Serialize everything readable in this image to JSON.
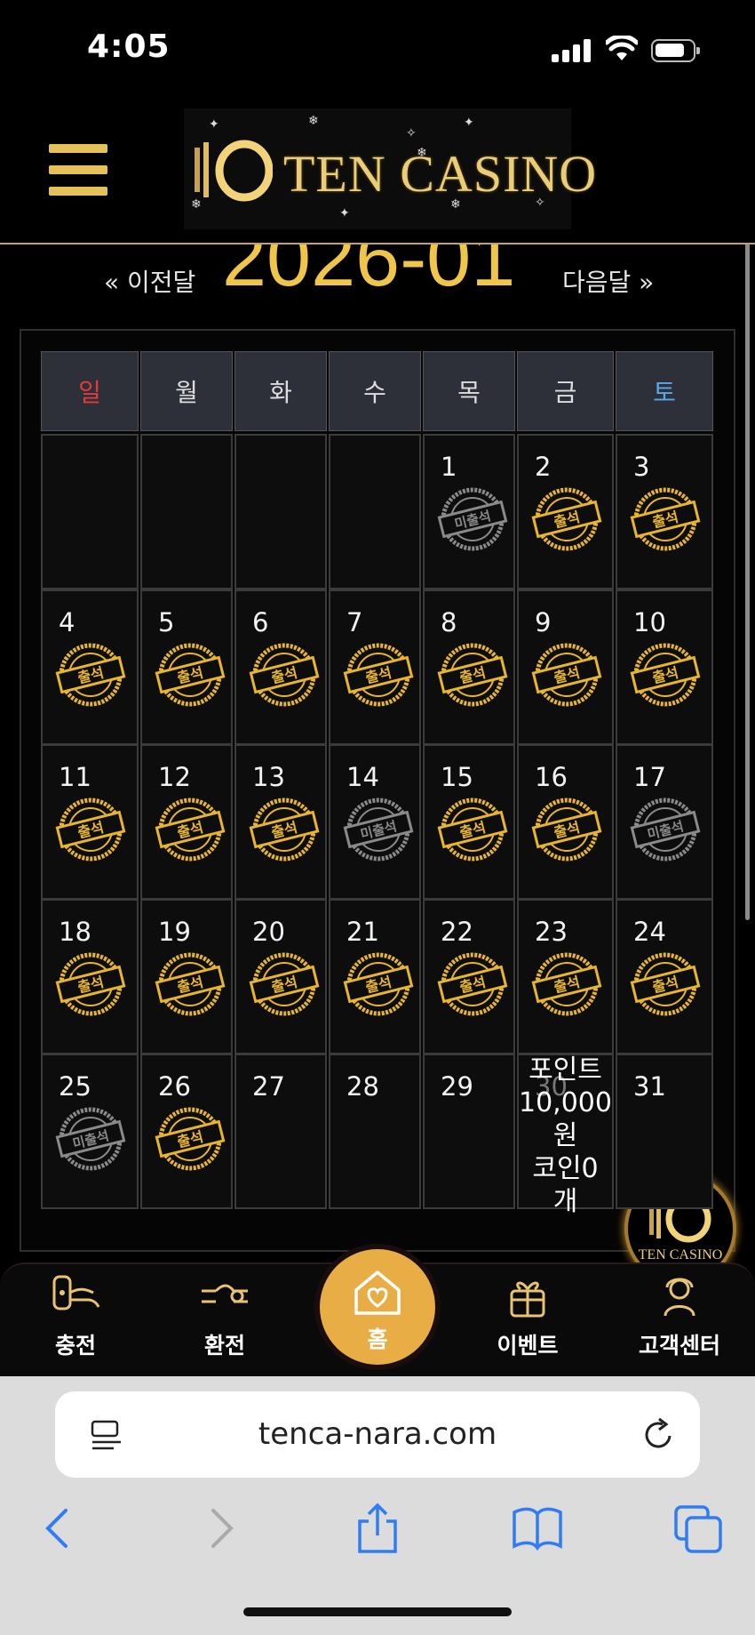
{
  "status_bar": {
    "time": "4:05"
  },
  "header": {
    "logo_text": "TEN CASINO"
  },
  "calendar": {
    "prev_label": "« 이전달",
    "next_label": "다음달 »",
    "month_title": "2026-01",
    "weekdays": [
      "일",
      "월",
      "화",
      "수",
      "목",
      "금",
      "토"
    ],
    "stamp_attended": "출석",
    "stamp_absent": "미출석",
    "days": [
      {
        "day": "1",
        "status": "absent"
      },
      {
        "day": "2",
        "status": "attended"
      },
      {
        "day": "3",
        "status": "attended"
      },
      {
        "day": "4",
        "status": "attended"
      },
      {
        "day": "5",
        "status": "attended"
      },
      {
        "day": "6",
        "status": "attended"
      },
      {
        "day": "7",
        "status": "attended"
      },
      {
        "day": "8",
        "status": "attended"
      },
      {
        "day": "9",
        "status": "attended"
      },
      {
        "day": "10",
        "status": "attended"
      },
      {
        "day": "11",
        "status": "attended"
      },
      {
        "day": "12",
        "status": "attended"
      },
      {
        "day": "13",
        "status": "attended"
      },
      {
        "day": "14",
        "status": "absent"
      },
      {
        "day": "15",
        "status": "attended"
      },
      {
        "day": "16",
        "status": "attended"
      },
      {
        "day": "17",
        "status": "absent"
      },
      {
        "day": "18",
        "status": "attended"
      },
      {
        "day": "19",
        "status": "attended"
      },
      {
        "day": "20",
        "status": "attended"
      },
      {
        "day": "21",
        "status": "attended"
      },
      {
        "day": "22",
        "status": "attended"
      },
      {
        "day": "23",
        "status": "attended"
      },
      {
        "day": "24",
        "status": "attended"
      },
      {
        "day": "25",
        "status": "absent"
      },
      {
        "day": "26",
        "status": "attended"
      },
      {
        "day": "27",
        "status": "none"
      },
      {
        "day": "28",
        "status": "none"
      },
      {
        "day": "29",
        "status": "none"
      },
      {
        "day": "30",
        "status": "none"
      },
      {
        "day": "31",
        "status": "none"
      }
    ],
    "reward_tooltip": "포인트\n10,000\n원\n코인0\n개"
  },
  "floating_logo_text": "TEN CASINO",
  "bottom_nav": {
    "charge": "충전",
    "exchange": "환전",
    "home": "홈",
    "event": "이벤트",
    "support": "고객센터"
  },
  "browser": {
    "url": "tenca-nara.com"
  },
  "colors": {
    "gold": "#e9ad45",
    "accent": "#f0c64a",
    "sunday": "#e23b3b",
    "saturday": "#5aa9e6",
    "ios_blue": "#2f7cf6"
  }
}
